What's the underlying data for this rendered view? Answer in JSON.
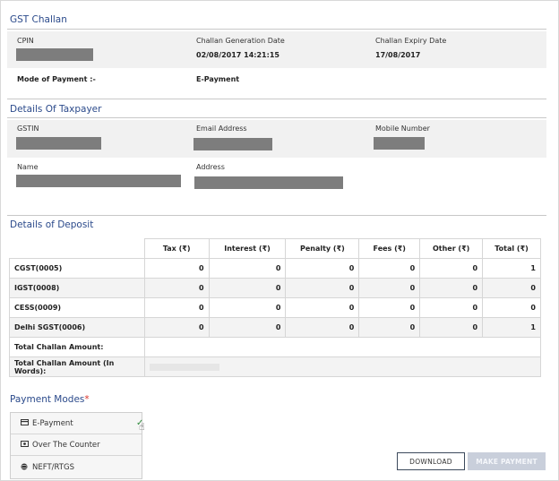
{
  "challan": {
    "title": "GST Challan",
    "cpin_label": "CPIN",
    "gen_date_label": "Challan Generation Date",
    "gen_date_value": "02/08/2017 14:21:15",
    "expiry_label": "Challan Expiry Date",
    "expiry_value": "17/08/2017",
    "mode_label": "Mode of Payment :-",
    "mode_value": "E-Payment"
  },
  "taxpayer": {
    "title": "Details Of Taxpayer",
    "gstin_label": "GSTIN",
    "email_label": "Email Address",
    "mobile_label": "Mobile Number",
    "name_label": "Name",
    "address_label": "Address"
  },
  "deposit": {
    "title": "Details of Deposit",
    "columns": [
      "Tax (₹)",
      "Interest (₹)",
      "Penalty (₹)",
      "Fees (₹)",
      "Other (₹)",
      "Total (₹)"
    ],
    "rows": [
      {
        "head": "CGST(0005)",
        "values": [
          "0",
          "0",
          "0",
          "0",
          "0",
          "1"
        ]
      },
      {
        "head": "IGST(0008)",
        "values": [
          "0",
          "0",
          "0",
          "0",
          "0",
          "0"
        ]
      },
      {
        "head": "CESS(0009)",
        "values": [
          "0",
          "0",
          "0",
          "0",
          "0",
          "0"
        ]
      },
      {
        "head": "Delhi SGST(0006)",
        "values": [
          "0",
          "0",
          "0",
          "0",
          "0",
          "1"
        ]
      }
    ],
    "total_label": "Total Challan Amount:",
    "total_words_label": "Total Challan Amount (In Words):"
  },
  "payment": {
    "title": "Payment Modes",
    "required_mark": "*",
    "options": [
      {
        "label": "E-Payment",
        "icon": "card-icon"
      },
      {
        "label": "Over The Counter",
        "icon": "counter-icon"
      },
      {
        "label": "NEFT/RTGS",
        "icon": "globe-icon"
      }
    ],
    "download_label": "DOWNLOAD",
    "make_payment_label": "MAKE PAYMENT"
  }
}
